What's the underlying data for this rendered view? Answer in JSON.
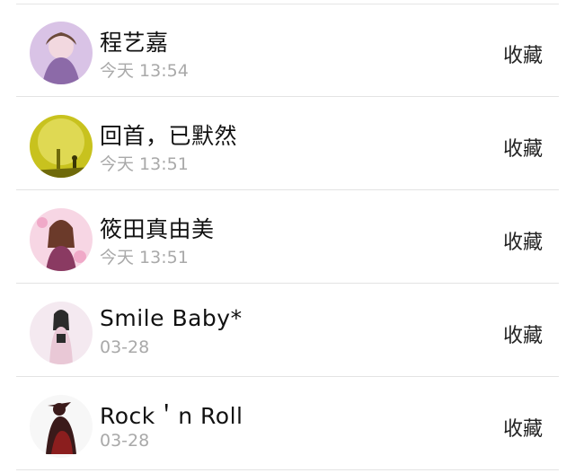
{
  "items": [
    {
      "name": "程艺嘉",
      "time": "今天 13:54",
      "action": "收藏",
      "avatar_palette": [
        "#d9c3e6",
        "#8c6aa8",
        "#f2d8df"
      ]
    },
    {
      "name": "回首，已默然",
      "time": "今天 13:51",
      "action": "收藏",
      "avatar_palette": [
        "#c8c21e",
        "#6f6a0a",
        "#e8e36a"
      ]
    },
    {
      "name": "筱田真由美",
      "time": "今天 13:51",
      "action": "收藏",
      "avatar_palette": [
        "#f0a9c8",
        "#8a3a62",
        "#f7d6e4"
      ]
    },
    {
      "name": "Smile Baby*",
      "time": "03-28",
      "action": "收藏",
      "avatar_palette": [
        "#f4e9f0",
        "#2b2b2b",
        "#e9c8d6"
      ]
    },
    {
      "name": "Rock＇n Roll",
      "time": "03-28",
      "action": "收藏",
      "avatar_palette": [
        "#f7f7f7",
        "#3a1a1a",
        "#8b1e1e"
      ]
    }
  ]
}
